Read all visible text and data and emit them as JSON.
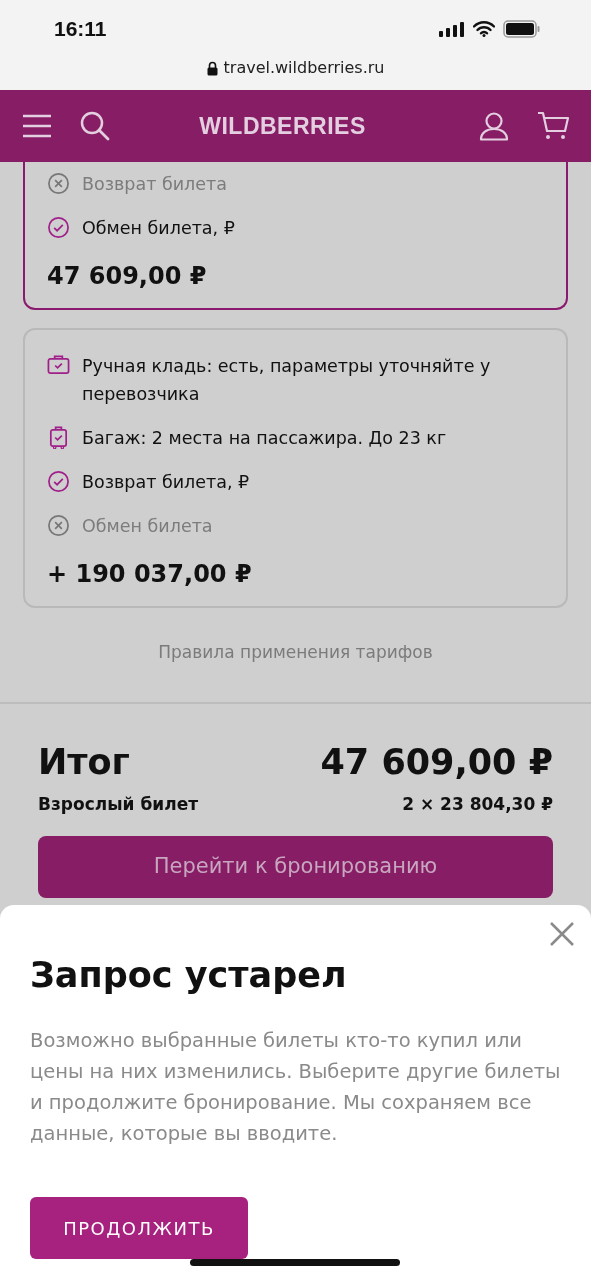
{
  "status_bar": {
    "time": "16:11"
  },
  "address_bar": {
    "url": "travel.wildberries.ru"
  },
  "header": {
    "logo": "WILDBERRIES"
  },
  "tariffs": [
    {
      "selected": true,
      "top_cut": true,
      "features": [
        {
          "kind": "excluded",
          "text": "Возврат билета"
        },
        {
          "kind": "included",
          "text": "Обмен билета, ₽"
        }
      ],
      "price": "47 609,00 ₽"
    },
    {
      "selected": false,
      "top_cut": false,
      "features": [
        {
          "kind": "hand_luggage",
          "text": "Ручная кладь: есть, параметры уточняйте у перевозчика"
        },
        {
          "kind": "baggage",
          "text": "Багаж: 2 места на пассажира. До 23 кг"
        },
        {
          "kind": "included",
          "text": "Возврат билета, ₽"
        },
        {
          "kind": "excluded",
          "text": "Обмен билета"
        }
      ],
      "price": "+ 190 037,00 ₽"
    }
  ],
  "rules_link": "Правила применения тарифов",
  "summary": {
    "title": "Итог",
    "total": "47 609,00 ₽",
    "passenger": "Взрослый билет",
    "passenger_price": "2 × 23 804,30 ₽",
    "book_button": "Перейти к бронированию"
  },
  "dialog": {
    "title": "Запрос устарел",
    "message": "Возможно выбранные билеты кто-то купил или цены на них изменились. Выберите другие билеты и продолжите бронирование. Мы сохраняем все данные, которые вы вводите.",
    "button": "ПРОДОЛЖИТЬ"
  }
}
